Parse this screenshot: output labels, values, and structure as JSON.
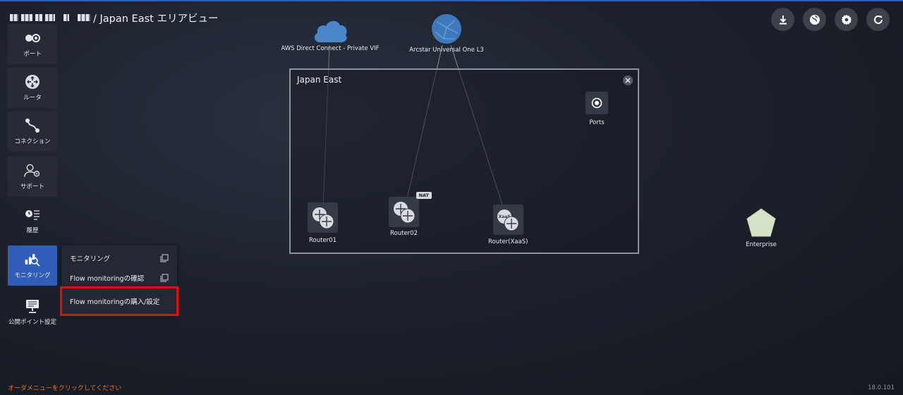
{
  "header": {
    "title_suffix": "/ Japan East エリアビュー"
  },
  "sidebar": {
    "items": [
      {
        "label": "ポート",
        "icon": "port-icon"
      },
      {
        "label": "ルータ",
        "icon": "router-icon"
      },
      {
        "label": "コネクション",
        "icon": "connection-icon"
      },
      {
        "label": "サポート",
        "icon": "support-icon"
      },
      {
        "label": "履歴",
        "icon": "history-icon"
      },
      {
        "label": "モニタリング",
        "icon": "monitoring-icon"
      },
      {
        "label": "公開ポイント設定",
        "icon": "public-point-icon"
      }
    ]
  },
  "menu": {
    "items": [
      {
        "label": "モニタリング",
        "icon": "copy-icon"
      },
      {
        "label": "Flow monitoringの確認",
        "icon": "copy-icon"
      },
      {
        "label": "Flow monitoringの購入/設定"
      }
    ]
  },
  "toolbar": {
    "buttons": [
      "download-icon",
      "globe-icon",
      "gear-icon",
      "refresh-icon"
    ]
  },
  "cloud_nodes": {
    "aws": "AWS Direct Connect - Private VIF",
    "arcstar": "Arcstar Universal One L3"
  },
  "area": {
    "title": "Japan East",
    "ports_label": "Ports",
    "routers": [
      {
        "label": "Router01"
      },
      {
        "label": "Router02",
        "badge": "NAT"
      },
      {
        "label": "Router(XaaS)",
        "badge_text": "XaaS"
      }
    ]
  },
  "enterprise": {
    "label": "Enterprise"
  },
  "footer": {
    "message": "オーダメニューをクリックしてください",
    "version": "18.0.101"
  },
  "colors": {
    "accent": "#2f5db8",
    "highlight": "#e01010",
    "footer_text": "#e8732a"
  }
}
